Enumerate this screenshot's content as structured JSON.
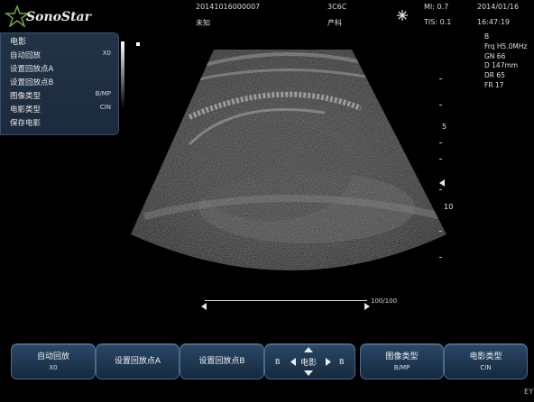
{
  "brand": {
    "name": "SonoStar"
  },
  "header": {
    "patient_id": "20141016000007",
    "patient_name": "未知",
    "preset_code": "3C6C",
    "exam_type": "产科",
    "mi": "MI: 0.7",
    "tis": "TIS: 0.1",
    "date": "2014/01/16",
    "time": "16:47:19",
    "freeze_icon": "snowflake-icon"
  },
  "menu": {
    "title": "电影",
    "items": [
      {
        "label": "自动回放",
        "value": "X0"
      },
      {
        "label": "设置回放点A",
        "value": ""
      },
      {
        "label": "设置回放点B",
        "value": ""
      },
      {
        "label": "图像类型",
        "value": "B/MP"
      },
      {
        "label": "电影类型",
        "value": "CIN"
      },
      {
        "label": "保存电影",
        "value": ""
      }
    ]
  },
  "params": {
    "mode": "B",
    "freq": "Frq H5.0MHz",
    "gain": "GN  66",
    "depth": "D   147mm",
    "dr": "DR  65",
    "fr": "FR  17"
  },
  "depth_scale": {
    "label_5": "5",
    "label_10": "10"
  },
  "cine": {
    "frames": "100/100"
  },
  "corner_label": "EY",
  "toolbar": {
    "buttons": [
      {
        "top": "自动回放",
        "bottom": "X0"
      },
      {
        "top": "设置回放点A",
        "bottom": ""
      },
      {
        "top": "设置回放点B",
        "bottom": ""
      },
      {
        "top": "B ◀ 电影 ▶ B",
        "bottom": ""
      },
      {
        "top": "图像类型",
        "bottom": "B/MP"
      },
      {
        "top": "电影类型",
        "bottom": "CIN"
      }
    ],
    "nav": {
      "left": "B",
      "center": "电影",
      "right": "B"
    }
  },
  "colors": {
    "menu_bg": "#1b2a3c",
    "button_bg": "#23405e",
    "accent_green": "#6fa84a"
  }
}
